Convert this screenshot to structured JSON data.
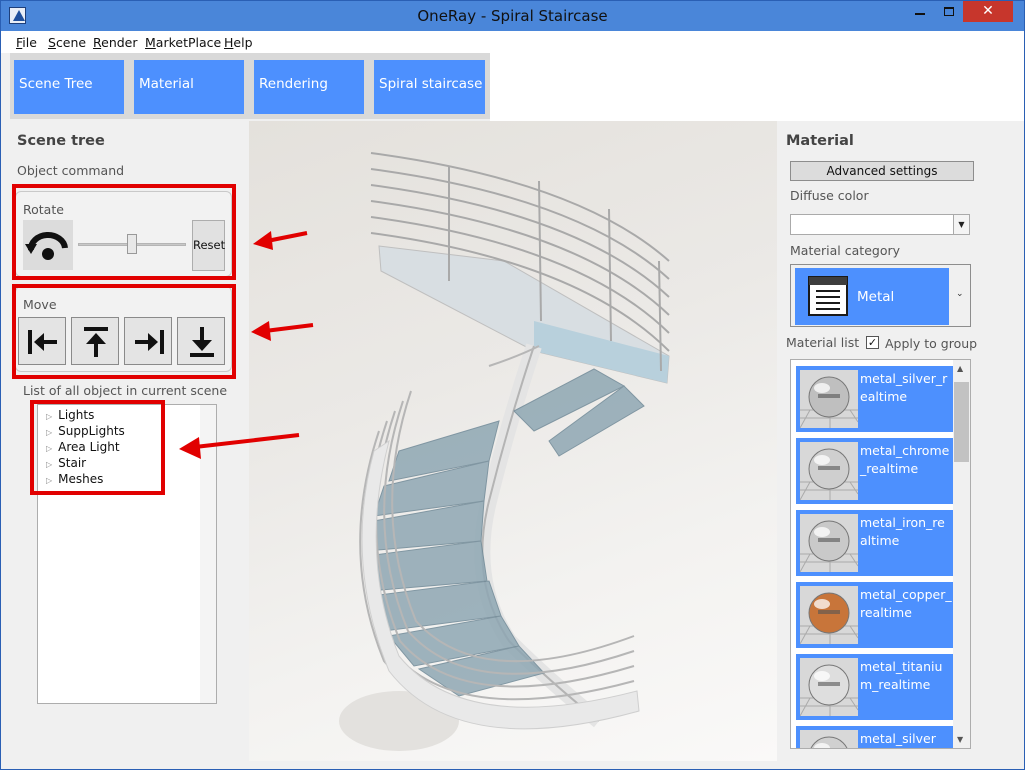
{
  "window": {
    "title": "OneRay - Spiral Staircase"
  },
  "menu": [
    {
      "label": "File",
      "u": "F",
      "rest": "ile"
    },
    {
      "label": "Scene",
      "u": "S",
      "rest": "cene"
    },
    {
      "label": "Render",
      "u": "R",
      "rest": "ender"
    },
    {
      "label": "MarketPlace",
      "u": "M",
      "rest": "arketPlace"
    },
    {
      "label": "Help",
      "u": "H",
      "rest": "elp"
    }
  ],
  "tabs": [
    "Scene Tree",
    "Material",
    "Rendering",
    "Spiral staircase"
  ],
  "left": {
    "title": "Scene tree",
    "object_command": "Object command",
    "rotate_label": "Rotate",
    "reset_label": "Reset",
    "move_label": "Move",
    "list_label": "List of all object in current scene",
    "tree": [
      "Lights",
      "SuppLights",
      "Area Light",
      "Stair",
      "Meshes"
    ]
  },
  "right": {
    "title": "Material",
    "advanced_label": "Advanced settings",
    "diffuse_label": "Diffuse color",
    "category_label": "Material category",
    "category_value": "Metal",
    "material_list_label": "Material list",
    "apply_group_label": "Apply to group",
    "apply_group_checked": true,
    "materials": [
      {
        "name": "metal_silver_realtime",
        "tone": "#bfbfbf"
      },
      {
        "name": "metal_chrome_realtime",
        "tone": "#cfcfcf"
      },
      {
        "name": "metal_iron_realtime",
        "tone": "#c9c9c9"
      },
      {
        "name": "metal_copper_realtime",
        "tone": "#c8753a"
      },
      {
        "name": "metal_titanium_realtime",
        "tone": "#dedede"
      },
      {
        "name": "metal_silver",
        "tone": "#d0d0d0"
      }
    ]
  },
  "colors": {
    "accent": "#4d90fe",
    "highlight": "#e10000",
    "titlebar": "#4a86d9"
  }
}
